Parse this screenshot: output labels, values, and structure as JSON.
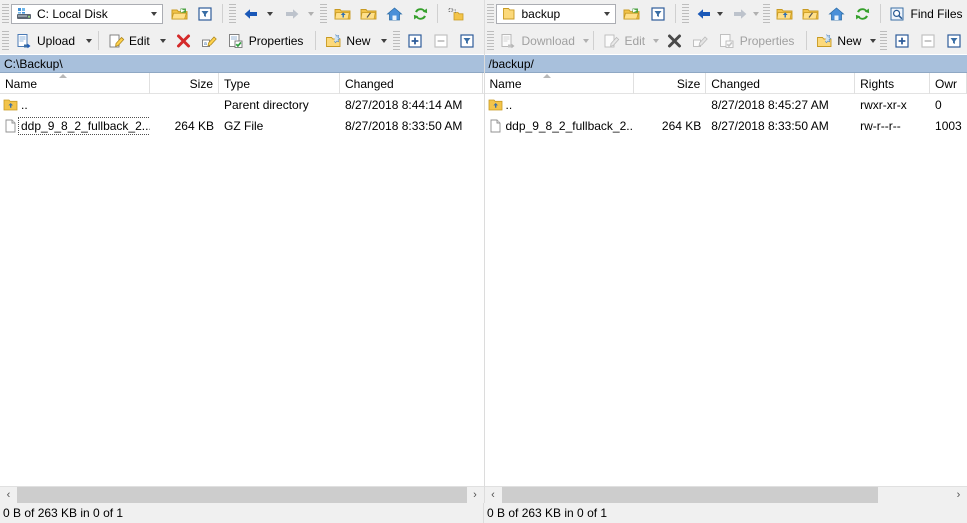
{
  "left_toolbar": {
    "path_combo": {
      "value": "C: Local Disk",
      "icon": "local-disk-icon"
    },
    "open_dir_label": "open-directory-icon",
    "filter_label": "filter-icon",
    "back_label": "back-arrow-icon",
    "forward_label": "forward-arrow-icon",
    "parent_label": "parent-directory-icon",
    "root_label": "root-directory-icon",
    "home_label": "home-directory-icon",
    "refresh_label": "refresh-icon",
    "bookmark_label": "add-bookmark-icon",
    "upload": "Upload",
    "edit": "Edit",
    "delete": "delete-icon",
    "rename": "rename-icon",
    "properties": "Properties",
    "new": "New",
    "select_add": "+",
    "select_remove": "–",
    "select_filter": "selection-filter-icon"
  },
  "right_toolbar": {
    "path_combo": {
      "value": "backup",
      "icon": "remote-folder-icon"
    },
    "find_files": "Find Files",
    "download": "Download",
    "edit": "Edit",
    "properties": "Properties",
    "new": "New",
    "select_add": "+",
    "select_remove": "–"
  },
  "left_pane": {
    "path": "C:\\Backup\\",
    "columns": [
      "Name",
      "Size",
      "Type",
      "Changed"
    ],
    "sort_column": "Name",
    "sort_direction": "asc",
    "rows": [
      {
        "name": "..",
        "size": "",
        "type": "Parent directory",
        "changed": "8/27/2018  8:44:14 AM",
        "icon": "parent-folder-icon",
        "focused": false
      },
      {
        "name": "ddp_9_8_2_fullback_2...",
        "size": "264 KB",
        "type": "GZ File",
        "changed": "8/27/2018  8:33:50 AM",
        "icon": "file-icon",
        "focused": true
      }
    ],
    "status": "0 B of 263 KB in 0 of 1",
    "scroll_left_arrow": "‹",
    "scroll_right_arrow": "›"
  },
  "right_pane": {
    "path": "/backup/",
    "columns": [
      "Name",
      "Size",
      "Changed",
      "Rights",
      "Owr"
    ],
    "sort_column": "Name",
    "sort_direction": "asc",
    "rows": [
      {
        "name": "..",
        "size": "",
        "changed": "8/27/2018 8:45:27 AM",
        "rights": "rwxr-xr-x",
        "owner": "0",
        "icon": "parent-folder-icon",
        "focused": false
      },
      {
        "name": "ddp_9_8_2_fullback_2...",
        "size": "264 KB",
        "changed": "8/27/2018 8:33:50 AM",
        "rights": "rw-r--r--",
        "owner": "1003",
        "icon": "file-icon",
        "focused": false
      }
    ],
    "status": "0 B of 263 KB in 0 of 1",
    "scroll_left_arrow": "‹",
    "scroll_right_arrow": "›"
  },
  "colors": {
    "path_bar": "#a8c0dc",
    "chrome": "#f0f0f0",
    "list_bg": "#ffffff",
    "folder_yellow": "#ffd24d",
    "accent_blue": "#1a58b8",
    "delete_red": "#d42a2a",
    "refresh_green": "#35a02b"
  }
}
